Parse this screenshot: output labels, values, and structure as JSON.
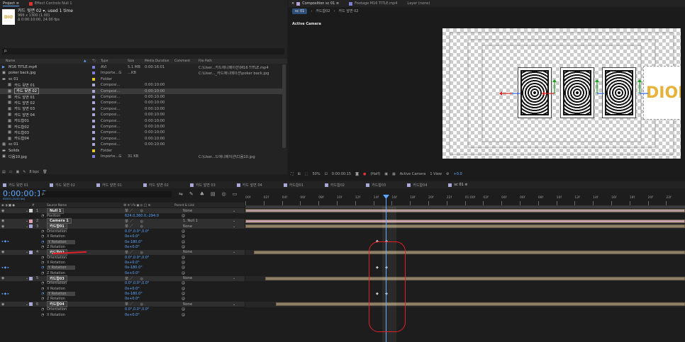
{
  "project_panel": {
    "tabs": [
      {
        "label": "Project ≡",
        "active": true
      },
      {
        "label": "Effect Controls Null 1",
        "active": false
      }
    ],
    "selected": {
      "name": "카드 뒷면 02 ▾",
      "used": ", used 1 time",
      "line1": "966 x 1300 (1.00)",
      "line2": "Δ 0:00:10:00, 24.00 fps"
    },
    "search_placeholder": "ρ.",
    "columns": [
      "Name",
      "Type",
      "Size",
      "Media Duration",
      "Comment",
      "File Path"
    ],
    "items": [
      {
        "indent": 0,
        "name": "M16 TITLE.mp4",
        "type": "AVI",
        "size": "5.1 MB",
        "duration": "0:00:16:01",
        "path": "C:\\User...카드애니메이션\\M16 TITLE.mp4",
        "color": "#7d7fd8",
        "icon": "video-icon",
        "selected": false
      },
      {
        "indent": 0,
        "name": "poker back.jpg",
        "type": "Importe...G",
        "size": "...KB",
        "duration": "",
        "path": "C:\\User..._카드애니메이션\\poker back.jpg",
        "color": "#7d7fd8",
        "icon": "image-icon",
        "selected": false
      },
      {
        "indent": 0,
        "name": "sc 01",
        "type": "Folder",
        "size": "",
        "duration": "",
        "path": "",
        "color": "#e6c82e",
        "icon": "folder-icon",
        "selected": false
      },
      {
        "indent": 1,
        "name": "카드 뒷면 01",
        "type": "Composi...",
        "size": "",
        "duration": "0:00:10:00",
        "path": "",
        "color": "#a9a9d9",
        "icon": "comp-icon",
        "selected": false
      },
      {
        "indent": 1,
        "name": "카드 뒷면 02",
        "type": "Composi...",
        "size": "",
        "duration": "0:00:10:00",
        "path": "",
        "color": "#a9a9d9",
        "icon": "comp-icon",
        "selected": true
      },
      {
        "indent": 1,
        "name": "카드 앞면 01",
        "type": "Composi...",
        "size": "",
        "duration": "0:00:10:00",
        "path": "",
        "color": "#a9a9d9",
        "icon": "comp-icon",
        "selected": false
      },
      {
        "indent": 1,
        "name": "카드 앞면 02",
        "type": "Composi...",
        "size": "",
        "duration": "0:00:10:00",
        "path": "",
        "color": "#a9a9d9",
        "icon": "comp-icon",
        "selected": false
      },
      {
        "indent": 1,
        "name": "카드 앞면 03",
        "type": "Composi...",
        "size": "",
        "duration": "0:00:10:00",
        "path": "",
        "color": "#a9a9d9",
        "icon": "comp-icon",
        "selected": false
      },
      {
        "indent": 1,
        "name": "카드 앞면 04",
        "type": "Composi...",
        "size": "",
        "duration": "0:00:10:00",
        "path": "",
        "color": "#a9a9d9",
        "icon": "comp-icon",
        "selected": false
      },
      {
        "indent": 1,
        "name": "카드합01",
        "type": "Composi...",
        "size": "",
        "duration": "0:00:10:00",
        "path": "",
        "color": "#a9a9d9",
        "icon": "comp-icon",
        "selected": false
      },
      {
        "indent": 1,
        "name": "카드합02",
        "type": "Composi...",
        "size": "",
        "duration": "0:00:10:00",
        "path": "",
        "color": "#a9a9d9",
        "icon": "comp-icon",
        "selected": false
      },
      {
        "indent": 1,
        "name": "카드합03",
        "type": "Composi...",
        "size": "",
        "duration": "0:00:10:00",
        "path": "",
        "color": "#a9a9d9",
        "icon": "comp-icon",
        "selected": false
      },
      {
        "indent": 1,
        "name": "카드합04",
        "type": "Composi...",
        "size": "",
        "duration": "0:00:10:00",
        "path": "",
        "color": "#a9a9d9",
        "icon": "comp-icon",
        "selected": false
      },
      {
        "indent": 0,
        "name": "sc 01",
        "type": "Composi...",
        "size": "",
        "duration": "0:00:10:00",
        "path": "",
        "color": "#a9a9d9",
        "icon": "comp-icon",
        "selected": false
      },
      {
        "indent": 0,
        "name": "Solids",
        "type": "Folder",
        "size": "",
        "duration": "",
        "path": "",
        "color": "#e6c82e",
        "icon": "folder-icon",
        "selected": false
      },
      {
        "indent": 0,
        "name": "디움10.jpg",
        "type": "Importe...G",
        "size": "31 KB",
        "duration": "",
        "path": "C:\\User...드애니메이션\\디움10.jpg",
        "color": "#7d7fd8",
        "icon": "image-icon",
        "selected": false
      }
    ],
    "footer_bpc": "8 bpc"
  },
  "comp_panel": {
    "tab_composition": "Composition sc 01 ≡",
    "tab_footage": "Footage M16 TITLE.mp4",
    "tab_layer": "Layer (none)",
    "breadcrumb": [
      "sc 01",
      "카드합02",
      "카드 앞면 02"
    ],
    "view_label": "Active Camera",
    "footer": {
      "zoom": "50%",
      "timecode": "0:00:00:15",
      "resolution": "(Half)",
      "camera": "Active Camera",
      "views": "1 View",
      "exposure": "+0.0"
    }
  },
  "timeline": {
    "tabs": [
      "카드 뒷면 01",
      "카드 뒷면 02",
      "카드 앞면 01",
      "카드 앞면 02",
      "카드 앞면 03",
      "카드 앞면 04",
      "카드합01",
      "카드합02",
      "카드합03",
      "카드합04",
      "sc 01 ≡"
    ],
    "tab_colors": [
      "#a9a9d9",
      "#a9a9d9",
      "#a9a9d9",
      "#a9a9d9",
      "#a9a9d9",
      "#a9a9d9",
      "#a9a9d9",
      "#a9a9d9",
      "#a9a9d9",
      "#a9a9d9",
      "#a9a9d9"
    ],
    "current_time": "0:00:00:15",
    "fps_label": "00015 (24.00 fps)",
    "search_placeholder": "ρ.",
    "headers": {
      "source_name": "Source Name",
      "switches": "单 ✲ \\ fx ▣ ◎ ◯ ⚙",
      "parent": "Parent & Link"
    },
    "ruler": [
      "00f",
      "02f",
      "04f",
      "06f",
      "08f",
      "10f",
      "12f",
      "14f",
      "16f",
      "18f",
      "20f",
      "22f",
      "01:00f",
      "02f",
      "04f",
      "06f",
      "08f",
      "10f",
      "12f",
      "14f",
      "16f",
      "18f",
      "20f",
      "22f"
    ],
    "rows": [
      {
        "kind": "layer",
        "num": "1",
        "name": "Null 1",
        "label_color": "#d6d6d6",
        "parent": "None",
        "bar": {
          "start": 0,
          "end": 1.0,
          "color": "#b59aa0"
        }
      },
      {
        "kind": "prop",
        "name": "Position",
        "value": "624.0,360.0,-294.0"
      },
      {
        "kind": "layer",
        "num": "2",
        "name": "Camera 1",
        "label_color": "#e0a0b0",
        "parent": "1. Null 1",
        "bar": {
          "start": 0,
          "end": 1.0,
          "color": "#c9a0ad"
        }
      },
      {
        "kind": "layer",
        "num": "3",
        "name": "카드합01",
        "label_color": "#a9a9d9",
        "parent": "None",
        "bar": {
          "start": 0.0,
          "end": 1.0,
          "color": "#8e8167"
        }
      },
      {
        "kind": "prop",
        "name": "Orientation",
        "value": "0.0°,0.0°,0.0°"
      },
      {
        "kind": "prop",
        "name": "X Rotation",
        "value": "0x+0.0°"
      },
      {
        "kind": "prop",
        "name": "Y Rotation",
        "value": "0x-180.0°",
        "keyframed": true,
        "highlight": true
      },
      {
        "kind": "prop",
        "name": "Z Rotation",
        "value": "0x+0.0°"
      },
      {
        "kind": "layer",
        "num": "4",
        "name": "카드합02",
        "label_color": "#a9a9d9",
        "parent": "None",
        "bar": {
          "start": 0.02,
          "end": 1.0,
          "color": "#8e8167"
        }
      },
      {
        "kind": "prop",
        "name": "Orientation",
        "value": "0.0°,0.0°,0.0°"
      },
      {
        "kind": "prop",
        "name": "X Rotation",
        "value": "0x+0.0°"
      },
      {
        "kind": "prop",
        "name": "Y Rotation",
        "value": "0x-180.0°",
        "keyframed": true,
        "highlight": true
      },
      {
        "kind": "prop",
        "name": "Z Rotation",
        "value": "0x+0.0°"
      },
      {
        "kind": "layer",
        "num": "5",
        "name": "카드합03",
        "label_color": "#a9a9d9",
        "parent": "None",
        "bar": {
          "start": 0.045,
          "end": 1.0,
          "color": "#8e8167"
        }
      },
      {
        "kind": "prop",
        "name": "Orientation",
        "value": "0.0°,0.0°,0.0°"
      },
      {
        "kind": "prop",
        "name": "X Rotation",
        "value": "0x+0.0°"
      },
      {
        "kind": "prop",
        "name": "Y Rotation",
        "value": "0x-180.0°",
        "keyframed": true,
        "highlight": true
      },
      {
        "kind": "prop",
        "name": "Z Rotation",
        "value": "0x+0.0°"
      },
      {
        "kind": "layer",
        "num": "6",
        "name": "카드합04",
        "label_color": "#a9a9d9",
        "parent": "None",
        "bar": {
          "start": 0.07,
          "end": 1.0,
          "color": "#8e8167"
        }
      },
      {
        "kind": "prop",
        "name": "Orientation",
        "value": "0.0°,0.0°,0.0°"
      },
      {
        "kind": "prop",
        "name": "X Rotation",
        "value": "0x+0.0°"
      }
    ],
    "annotation_color": "#e0202a"
  }
}
